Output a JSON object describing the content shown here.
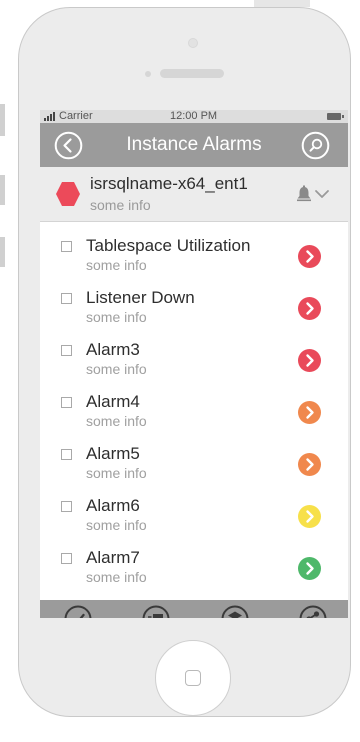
{
  "status_bar": {
    "carrier": "Carrier",
    "time": "12:00 PM"
  },
  "nav": {
    "title": "Instance Alarms",
    "back_icon": "chevron-left-circle-icon",
    "search_icon": "search-icon"
  },
  "instance": {
    "name": "isrsqlname-x64_ent1",
    "info": "some info",
    "status_color": "#ec4a5a"
  },
  "alarms": [
    {
      "name": "Tablespace Utilization",
      "info": "some info",
      "color": "#e94a5a"
    },
    {
      "name": "Listener Down",
      "info": "some info",
      "color": "#e94a5a"
    },
    {
      "name": "Alarm3",
      "info": "some info",
      "color": "#e94a5a"
    },
    {
      "name": "Alarm4",
      "info": "some info",
      "color": "#f0884d"
    },
    {
      "name": "Alarm5",
      "info": "some info",
      "color": "#f0884d"
    },
    {
      "name": "Alarm6",
      "info": "some info",
      "color": "#f7e04a"
    },
    {
      "name": "Alarm7",
      "info": "some info",
      "color": "#4eb86a"
    }
  ],
  "toolbar": {
    "icons": [
      "check-circle-icon",
      "comment-icon",
      "layers-icon",
      "share-icon"
    ]
  },
  "colors": {
    "bar": "#9b9b9b",
    "phone_body": "#ececec"
  }
}
